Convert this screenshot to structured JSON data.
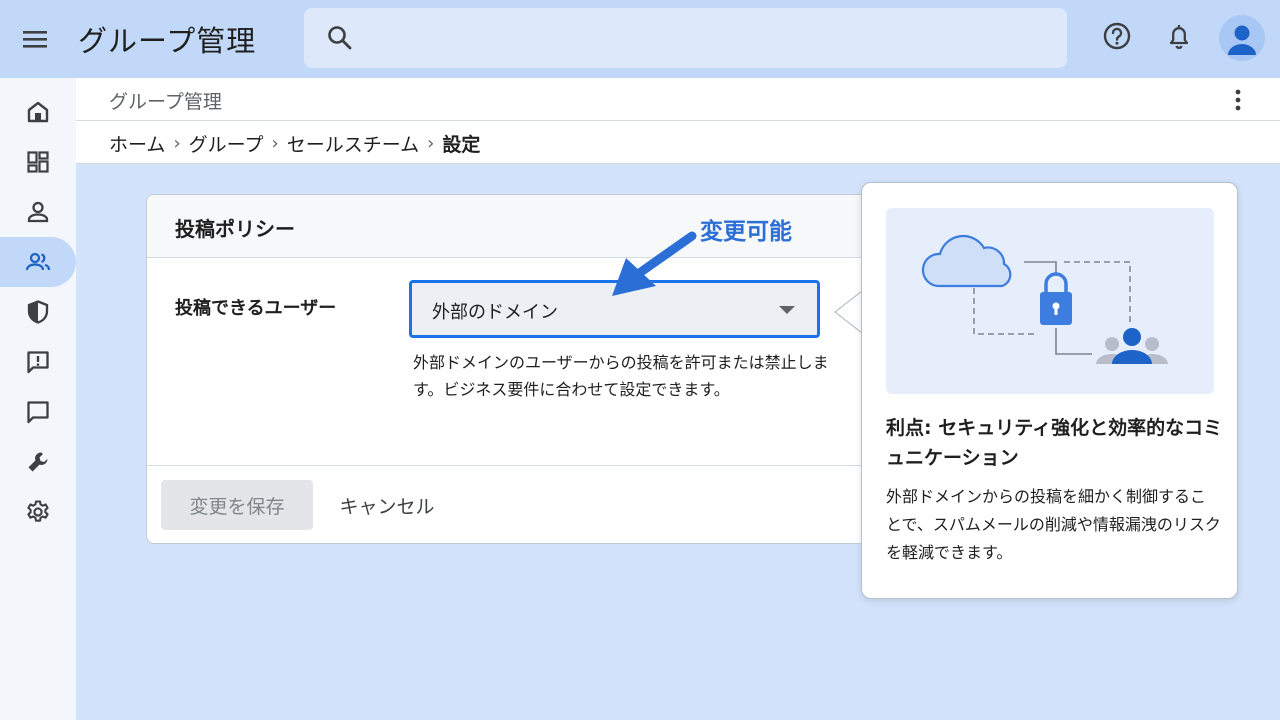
{
  "app": {
    "title": "グループ管理"
  },
  "search": {
    "placeholder": ""
  },
  "header": {
    "subtitle": "グループ管理",
    "breadcrumb": [
      "ホーム",
      "グループ",
      "セールスチーム",
      "設定"
    ]
  },
  "rail": {
    "items": [
      "home-icon",
      "dashboard-icon",
      "person-icon",
      "group-icon",
      "shield-icon",
      "feedback-icon",
      "chat-icon",
      "wrench-icon",
      "settings-icon"
    ],
    "active_index": 3
  },
  "card": {
    "title": "投稿ポリシー",
    "field_label": "投稿できるユーザー",
    "select_value": "外部のドメイン",
    "helper_text": "外部ドメインのユーザーからの投稿を許可または禁止します。ビジネス要件に合わせて設定できます。",
    "save_label": "変更を保存",
    "cancel_label": "キャンセル"
  },
  "annotation": {
    "text": "変更可能"
  },
  "popover": {
    "title": "利点: セキュリティ強化と効率的なコミュニケーション",
    "body": "外部ドメインからの投稿を細かく制御することで、スパムメールの削減や情報漏洩のリスクを軽減できます。"
  },
  "colors": {
    "accent": "#1a73e8",
    "annotation": "#2b6fd6",
    "topbar": "#c2d8f8",
    "background": "#d3e3fb"
  }
}
